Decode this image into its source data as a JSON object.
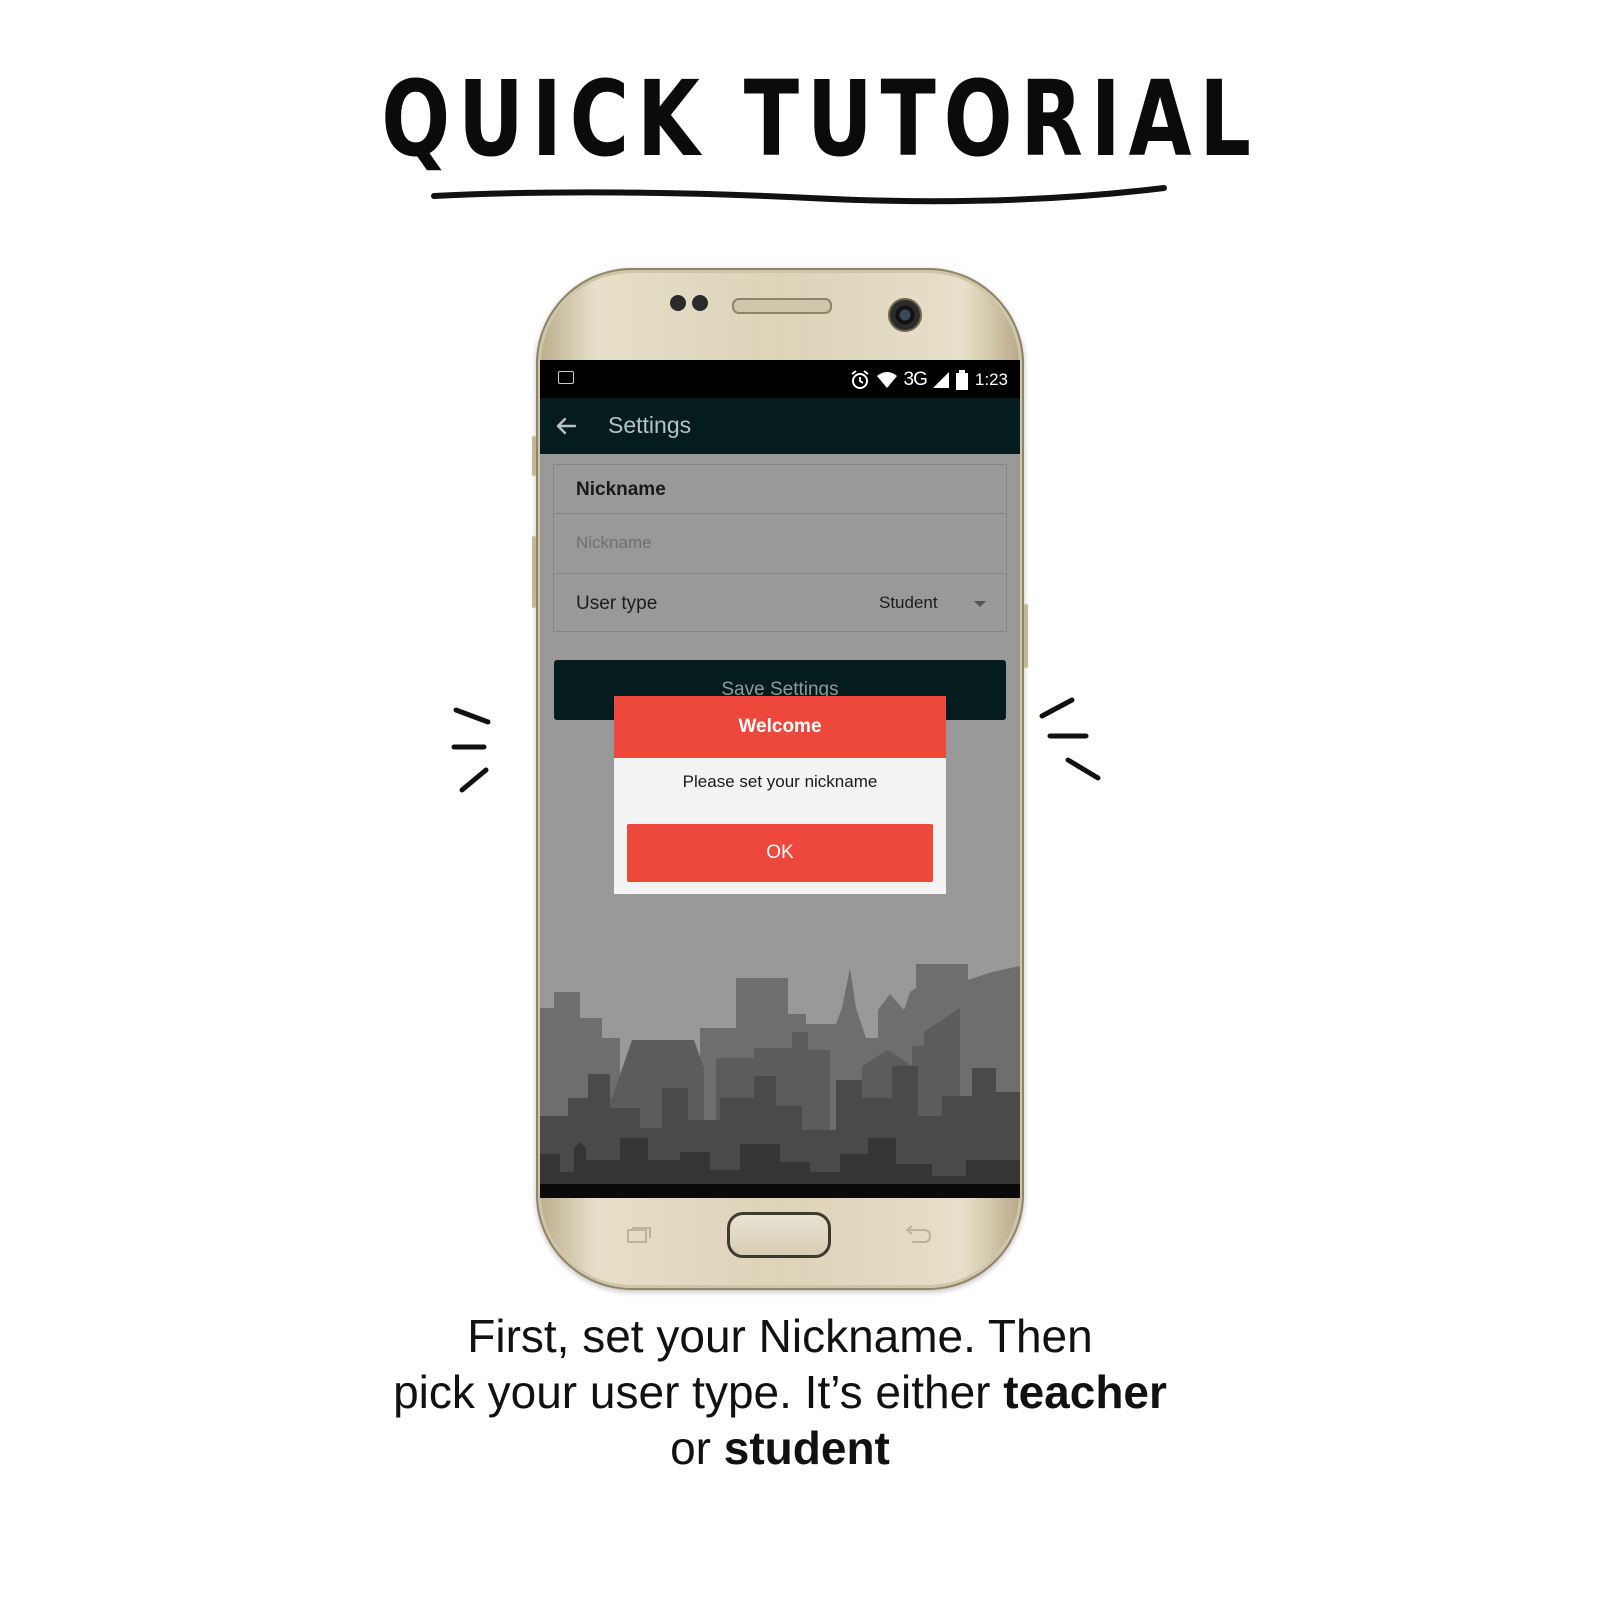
{
  "heading": {
    "title": "QUICK TUTORIAL"
  },
  "status_bar": {
    "network": "3G",
    "time": "1:23"
  },
  "app_bar": {
    "title": "Settings"
  },
  "settings_form": {
    "section_label": "Nickname",
    "nickname_placeholder": "Nickname",
    "user_type_label": "User type",
    "user_type_value": "Student",
    "save_label": "Save Settings"
  },
  "dialog": {
    "title": "Welcome",
    "message": "Please set your nickname",
    "ok_label": "OK"
  },
  "caption": {
    "line1": "First, set your Nickname. Then",
    "line2_prefix": "pick your user type. It’s either ",
    "line2_bold": "teacher",
    "line3_prefix": "or ",
    "line3_bold": "student"
  },
  "colors": {
    "accent_red": "#ee473c",
    "appbar_dark": "#051c1f",
    "overlay_gray": "#999999",
    "phone_gold": "#ddd3b9"
  },
  "icons": [
    "back-arrow-icon",
    "alarm-icon",
    "wifi-icon",
    "signal-icon",
    "battery-icon",
    "image-notification-icon",
    "dropdown-arrow-icon",
    "recent-apps-icon",
    "back-key-icon"
  ]
}
